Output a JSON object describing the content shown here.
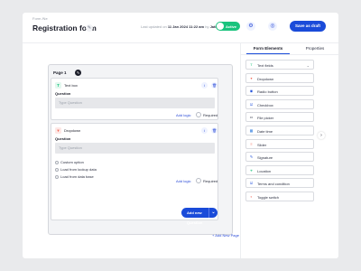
{
  "header": {
    "breadcrumb": "Form /Ne",
    "title": "Registration form",
    "updated_prefix": "Last updated on",
    "updated_date": "11 Jan 2024 11:22 am",
    "updated_by": "by",
    "updated_user": "Jatin",
    "toggle_label": "Active",
    "save_label": "Save as draft"
  },
  "page": {
    "label": "Page 1",
    "cards": [
      {
        "type": "Text box",
        "question_label": "Question",
        "placeholder": "Type Question",
        "add_logic": "Add logic",
        "required": "Required"
      },
      {
        "type": "Dropdown",
        "question_label": "Question",
        "placeholder": "Type Question",
        "options": [
          "Custom option",
          "Load from lookup data",
          "Load from data base"
        ],
        "add_logic": "Add logic",
        "required": "Required"
      }
    ],
    "add_question": "Add new Question",
    "add_page": "Add New Page"
  },
  "panel": {
    "tabs": [
      "Form Elements",
      "Properties"
    ],
    "elements": [
      {
        "label": "Text fields",
        "icon": "text-field-icon",
        "color": "#19c37d",
        "glyph": "T"
      },
      {
        "label": "Dropdown",
        "icon": "dropdown-icon",
        "color": "#f26b5b",
        "glyph": "▾"
      },
      {
        "label": "Radio button",
        "icon": "radio-icon",
        "color": "#1a4bd9",
        "glyph": "◉"
      },
      {
        "label": "Checkbox",
        "icon": "checkbox-icon",
        "color": "#1a4bd9",
        "glyph": "☑"
      },
      {
        "label": "File picker",
        "icon": "folder-icon",
        "color": "#2d3142",
        "glyph": "▭"
      },
      {
        "label": "Date time",
        "icon": "calendar-icon",
        "color": "#2a7ade",
        "glyph": "▦"
      },
      {
        "label": "Slider",
        "icon": "slider-icon",
        "color": "#f26b5b",
        "glyph": "≡"
      },
      {
        "label": "Signature",
        "icon": "signature-icon",
        "color": "#1a4bd9",
        "glyph": "✎"
      },
      {
        "label": "Location",
        "icon": "location-icon",
        "color": "#19c37d",
        "glyph": "⌖"
      },
      {
        "label": "Terms and condition",
        "icon": "terms-icon",
        "color": "#1a4bd9",
        "glyph": "☑"
      },
      {
        "label": "Toggle switch",
        "icon": "toggle-icon",
        "color": "#f26b5b",
        "glyph": "◐"
      }
    ]
  },
  "colors": {
    "accent": "#1a4bd9",
    "active": "#19c37d"
  }
}
